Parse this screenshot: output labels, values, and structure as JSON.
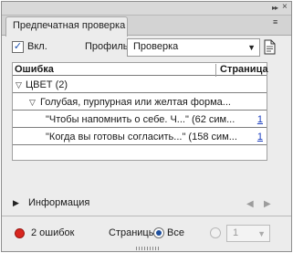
{
  "panel": {
    "tab_title": "Предпечатная проверка",
    "collapse_glyph": "▸▸",
    "close_glyph": "×",
    "menu_glyph": "≡"
  },
  "controls": {
    "enable_label": "Вкл.",
    "enable_checked": true,
    "profile_label": "Профиль:",
    "profile_value": "Проверка",
    "profile_icon": "document-icon"
  },
  "list": {
    "columns": {
      "error": "Ошибка",
      "page": "Страница"
    },
    "rows": [
      {
        "text": "ЦВЕТ (2)",
        "level": 0,
        "expanded": true,
        "page": ""
      },
      {
        "text": "Голубая, пурпурная или желтая форма...",
        "level": 1,
        "expanded": true,
        "page": ""
      },
      {
        "text": "\"Чтобы напомнить о себе. Ч...\" (62 сим...",
        "level": 2,
        "page": "1"
      },
      {
        "text": "\"Когда вы готовы согласить...\" (158 сим...",
        "level": 2,
        "page": "1"
      }
    ]
  },
  "info": {
    "label": "Информация",
    "prev_glyph": "◀",
    "next_glyph": "▶"
  },
  "status": {
    "errors_text": "2 ошибок",
    "dot_color": "#d8261f",
    "pages_label": "Страницы:",
    "all_label": "Все",
    "all_selected": true,
    "page_value": "1"
  },
  "colors": {
    "accent": "#1d4f9e",
    "link": "#1a3dbf",
    "error": "#d8261f"
  }
}
